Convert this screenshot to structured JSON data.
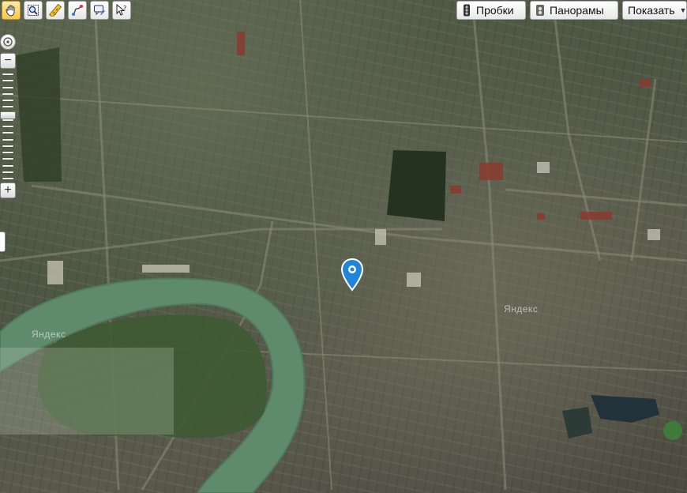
{
  "map": {
    "watermark": "Яндекс",
    "zoom_level_fraction": 0.6
  },
  "toolbar": {
    "tools": [
      {
        "name": "hand-icon",
        "active": true
      },
      {
        "name": "magnifier-zoom-icon",
        "active": false
      },
      {
        "name": "ruler-icon",
        "active": false
      },
      {
        "name": "route-icon",
        "active": false
      },
      {
        "name": "balloon-edit-icon",
        "active": false
      },
      {
        "name": "help-cursor-icon",
        "active": false
      }
    ]
  },
  "layers": {
    "traffic_label": "Пробки",
    "panoramas_label": "Панорамы",
    "show_label": "Показать"
  },
  "zoom": {
    "plus": "+",
    "minus": "−"
  },
  "colors": {
    "river": "#5f8a6c",
    "river_bank": "#4f7a5d",
    "pin": "#1e86d8",
    "roads": "#8a8570"
  }
}
